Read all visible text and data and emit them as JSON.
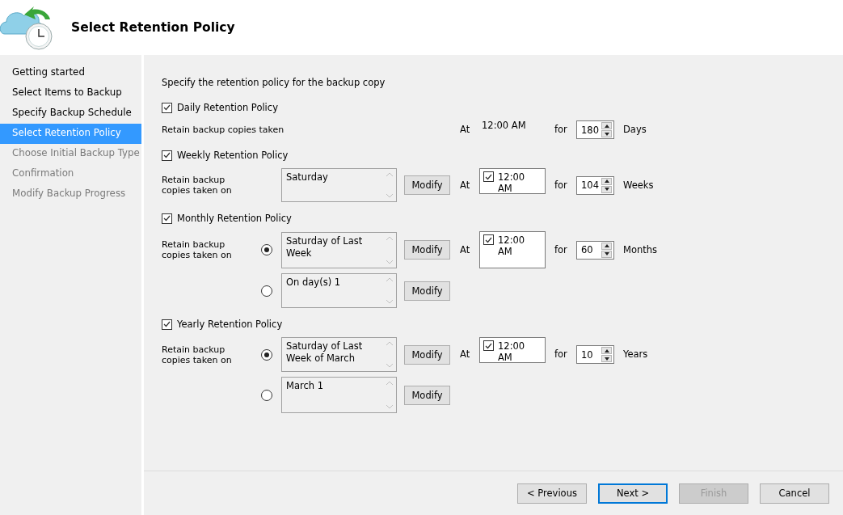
{
  "header": {
    "title": "Select Retention Policy"
  },
  "steps": [
    {
      "label": "Getting started",
      "selected": false,
      "disabled": false
    },
    {
      "label": "Select Items to Backup",
      "selected": false,
      "disabled": false
    },
    {
      "label": "Specify Backup Schedule",
      "selected": false,
      "disabled": false
    },
    {
      "label": "Select Retention Policy",
      "selected": true,
      "disabled": false
    },
    {
      "label": "Choose Initial Backup Type",
      "selected": false,
      "disabled": true
    },
    {
      "label": "Confirmation",
      "selected": false,
      "disabled": true
    },
    {
      "label": "Modify Backup Progress",
      "selected": false,
      "disabled": true
    }
  ],
  "intro": "Specify the retention policy for the backup copy",
  "policies": [
    {
      "kind": "daily",
      "label": "Daily Retention Policy",
      "checked": true,
      "retain_label": "Retain backup copies taken",
      "at_label": "At",
      "time": "12:00 AM",
      "for_label": "for",
      "count": "180",
      "unit": "Days"
    },
    {
      "kind": "weekly",
      "label": "Weekly Retention Policy",
      "checked": true,
      "retain_label": "Retain backup copies taken on",
      "at_label": "At",
      "time": "12:00 AM",
      "time_checked": true,
      "for_label": "for",
      "count": "104",
      "unit": "Weeks",
      "options": [
        {
          "text": "Saturday",
          "button": "Modify"
        }
      ]
    },
    {
      "kind": "monthly",
      "label": "Monthly Retention Policy",
      "checked": true,
      "retain_label": "Retain backup copies taken on",
      "at_label": "At",
      "time": "12:00 AM",
      "time_checked": true,
      "for_label": "for",
      "count": "60",
      "unit": "Months",
      "options": [
        {
          "text": "Saturday of Last Week",
          "button": "Modify",
          "selected": true
        },
        {
          "text": "On day(s) 1",
          "button": "Modify",
          "selected": false
        }
      ]
    },
    {
      "kind": "yearly",
      "label": "Yearly Retention Policy",
      "checked": true,
      "retain_label": "Retain backup copies taken on",
      "at_label": "At",
      "time": "12:00 AM",
      "time_checked": true,
      "for_label": "for",
      "count": "10",
      "unit": "Years",
      "options": [
        {
          "text": "Saturday of Last Week of March",
          "button": "Modify",
          "selected": true
        },
        {
          "text": "March 1",
          "button": "Modify",
          "selected": false
        }
      ]
    }
  ],
  "buttons": [
    {
      "label": "< Previous",
      "disabled": false,
      "focused": false
    },
    {
      "label": "Next >",
      "disabled": false,
      "focused": true
    },
    {
      "label": "Finish",
      "disabled": true,
      "focused": false
    },
    {
      "label": "Cancel",
      "disabled": false,
      "focused": false
    }
  ]
}
